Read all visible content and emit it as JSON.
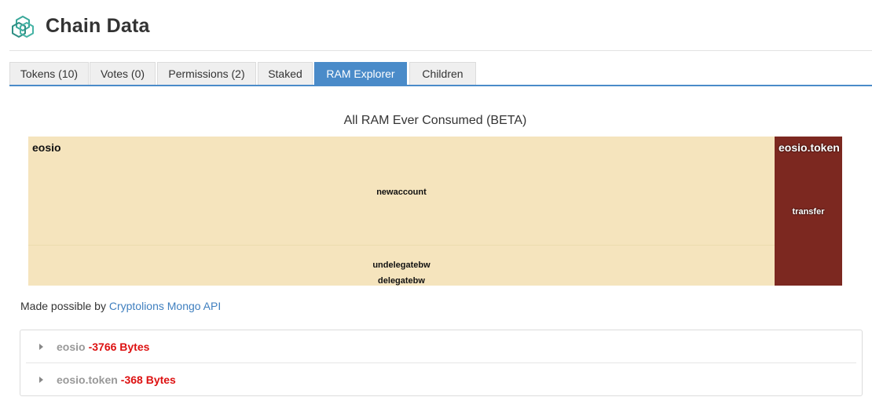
{
  "page": {
    "title": "Chain Data",
    "logo_icon": "hexagon-cubes-icon",
    "accent_color": "#4a8bc9"
  },
  "tabs": [
    {
      "label": "Tokens (10)",
      "active": false
    },
    {
      "label": "Votes (0)",
      "active": false
    },
    {
      "label": "Permissions (2)",
      "active": false
    },
    {
      "label": "Staked",
      "active": false
    },
    {
      "label": "RAM Explorer",
      "active": true
    },
    {
      "label": "Children",
      "active": false
    }
  ],
  "treemap": {
    "title": "All RAM Ever Consumed (BETA)",
    "groups": [
      {
        "name": "eosio",
        "color": "#f5e4bd",
        "leaves": [
          "newaccount",
          "undelegatebw",
          "delegatebw"
        ]
      },
      {
        "name": "eosio.token",
        "color": "#7c2820",
        "leaves": [
          "transfer"
        ]
      }
    ]
  },
  "credit": {
    "prefix": "Made possible by",
    "link_text": "Cryptolions Mongo API"
  },
  "accounts": [
    {
      "name": "eosio",
      "bytes": "-3766 Bytes"
    },
    {
      "name": "eosio.token",
      "bytes": "-368 Bytes"
    }
  ]
}
